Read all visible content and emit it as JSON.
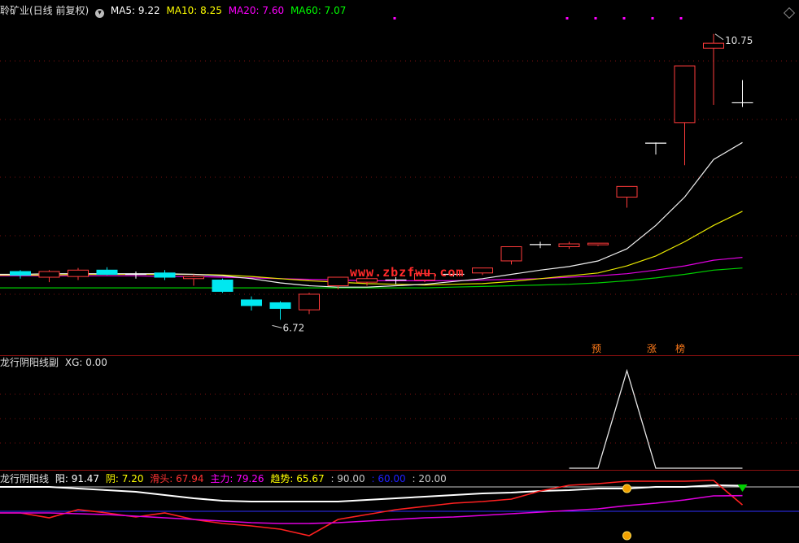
{
  "main": {
    "stock_title": "聆矿业(日线 前复权)",
    "ma": [
      {
        "label": "MA5: 9.22",
        "color": "#ffffff"
      },
      {
        "label": "MA10: 8.25",
        "color": "#ffff00"
      },
      {
        "label": "MA20: 7.60",
        "color": "#ff00ff"
      },
      {
        "label": "MA60: 7.07",
        "color": "#00ff00"
      }
    ],
    "high_label": "10.75",
    "low_label": "6.72",
    "watermark": "www.zbzfwu.com",
    "tags": [
      "预",
      "涨",
      "榜"
    ]
  },
  "sub1": {
    "title": "龙行阴阳线副",
    "xg": "XG: 0.00"
  },
  "sub2": {
    "title": "龙行阴阳线",
    "items": [
      {
        "label": "阳: 91.47",
        "color": "#ffffff"
      },
      {
        "label": "阴: 7.20",
        "color": "#ffff00"
      },
      {
        "label": "滑头: 67.94",
        "color": "#ff3333"
      },
      {
        "label": "主力: 79.26",
        "color": "#ff00ff"
      },
      {
        "label": "趋势: 65.67",
        "color": "#ffff00"
      },
      {
        "label": ": 90.00",
        "color": "#c8c8c8"
      },
      {
        "label": ": 60.00",
        "color": "#2020ff"
      },
      {
        "label": ": 20.00",
        "color": "#c8c8c8"
      }
    ]
  },
  "chart_data": [
    {
      "type": "candlestick",
      "title": "聆矿业(日线 前复权)",
      "ylim": [
        6.3,
        11.0
      ],
      "candles": [
        {
          "o": 7.4,
          "h": 7.42,
          "l": 7.3,
          "c": 7.35
        },
        {
          "o": 7.32,
          "h": 7.42,
          "l": 7.25,
          "c": 7.4
        },
        {
          "o": 7.33,
          "h": 7.45,
          "l": 7.28,
          "c": 7.42
        },
        {
          "o": 7.42,
          "h": 7.46,
          "l": 7.35,
          "c": 7.36
        },
        {
          "o": 7.36,
          "h": 7.4,
          "l": 7.3,
          "c": 7.35
        },
        {
          "o": 7.38,
          "h": 7.42,
          "l": 7.28,
          "c": 7.32
        },
        {
          "o": 7.3,
          "h": 7.36,
          "l": 7.2,
          "c": 7.33
        },
        {
          "o": 7.28,
          "h": 7.3,
          "l": 7.1,
          "c": 7.12
        },
        {
          "o": 7.0,
          "h": 7.05,
          "l": 6.85,
          "c": 6.92
        },
        {
          "o": 6.96,
          "h": 6.98,
          "l": 6.72,
          "c": 6.88
        },
        {
          "o": 6.86,
          "h": 7.1,
          "l": 6.8,
          "c": 7.08
        },
        {
          "o": 7.2,
          "h": 7.32,
          "l": 7.15,
          "c": 7.32
        },
        {
          "o": 7.25,
          "h": 7.34,
          "l": 7.2,
          "c": 7.3
        },
        {
          "o": 7.28,
          "h": 7.32,
          "l": 7.22,
          "c": 7.27
        },
        {
          "o": 7.28,
          "h": 7.39,
          "l": 7.25,
          "c": 7.37
        },
        {
          "o": 7.36,
          "h": 7.39,
          "l": 7.33,
          "c": 7.35
        },
        {
          "o": 7.38,
          "h": 7.45,
          "l": 7.35,
          "c": 7.45
        },
        {
          "o": 7.55,
          "h": 7.75,
          "l": 7.5,
          "c": 7.75
        },
        {
          "o": 7.78,
          "h": 7.82,
          "l": 7.73,
          "c": 7.77
        },
        {
          "o": 7.75,
          "h": 7.82,
          "l": 7.72,
          "c": 7.79
        },
        {
          "o": 7.78,
          "h": 7.8,
          "l": 7.76,
          "c": 7.8
        },
        {
          "o": 8.45,
          "h": 8.55,
          "l": 8.3,
          "c": 8.6
        },
        {
          "o": 9.2,
          "h": 9.22,
          "l": 9.05,
          "c": 9.21
        },
        {
          "o": 9.5,
          "h": 9.5,
          "l": 8.9,
          "c": 10.3
        },
        {
          "o": 10.55,
          "h": 10.75,
          "l": 9.75,
          "c": 10.62
        },
        {
          "o": 9.78,
          "h": 10.1,
          "l": 9.72,
          "c": 9.78
        }
      ],
      "ma5": [
        7.36,
        7.37,
        7.37,
        7.37,
        7.37,
        7.37,
        7.36,
        7.34,
        7.3,
        7.24,
        7.2,
        7.18,
        7.18,
        7.2,
        7.22,
        7.26,
        7.3,
        7.36,
        7.42,
        7.47,
        7.55,
        7.72,
        8.05,
        8.45,
        8.98,
        9.22
      ],
      "ma10": [
        7.35,
        7.35,
        7.36,
        7.36,
        7.36,
        7.36,
        7.36,
        7.35,
        7.33,
        7.3,
        7.27,
        7.25,
        7.23,
        7.22,
        7.21,
        7.22,
        7.23,
        7.26,
        7.3,
        7.34,
        7.38,
        7.48,
        7.62,
        7.82,
        8.05,
        8.25
      ],
      "ma20": [
        7.34,
        7.34,
        7.34,
        7.34,
        7.34,
        7.33,
        7.33,
        7.32,
        7.31,
        7.3,
        7.29,
        7.28,
        7.27,
        7.27,
        7.27,
        7.27,
        7.28,
        7.29,
        7.3,
        7.32,
        7.34,
        7.37,
        7.42,
        7.48,
        7.56,
        7.6
      ],
      "ma60": [
        7.17,
        7.17,
        7.17,
        7.17,
        7.17,
        7.17,
        7.17,
        7.17,
        7.17,
        7.17,
        7.17,
        7.17,
        7.17,
        7.17,
        7.17,
        7.18,
        7.19,
        7.2,
        7.21,
        7.22,
        7.24,
        7.27,
        7.31,
        7.36,
        7.42,
        7.45
      ]
    },
    {
      "type": "line",
      "title": "龙行阴阳线副",
      "ylim": [
        0,
        1
      ],
      "series": [
        {
          "name": "XG",
          "values": [
            0,
            0,
            0,
            0,
            0,
            0,
            0,
            0,
            0,
            0,
            0,
            0,
            0,
            0,
            0,
            0,
            0,
            0,
            0,
            0,
            0,
            1,
            0,
            0,
            0,
            0
          ]
        }
      ]
    },
    {
      "type": "line",
      "title": "龙行阴阳线",
      "ylim": [
        0,
        100
      ],
      "reference_lines": [
        90,
        60,
        20
      ],
      "series": [
        {
          "name": "阳",
          "values": [
            90,
            90,
            88,
            86,
            84,
            80,
            76,
            73,
            72,
            72,
            72,
            72,
            74,
            76,
            78,
            80,
            82,
            83,
            85,
            86,
            88,
            88,
            90,
            90,
            92,
            91.47
          ]
        },
        {
          "name": "滑头",
          "values": [
            58,
            52,
            62,
            58,
            53,
            58,
            50,
            45,
            42,
            38,
            30,
            50,
            56,
            62,
            66,
            70,
            72,
            75,
            85,
            92,
            94,
            97,
            97,
            97,
            98,
            67.94
          ]
        },
        {
          "name": "主力",
          "values": [
            58,
            58,
            57,
            56,
            54,
            52,
            50,
            48,
            46,
            45,
            45,
            46,
            48,
            50,
            52,
            53,
            55,
            57,
            59,
            61,
            63,
            67,
            70,
            74,
            79,
            79.26
          ]
        }
      ]
    }
  ]
}
